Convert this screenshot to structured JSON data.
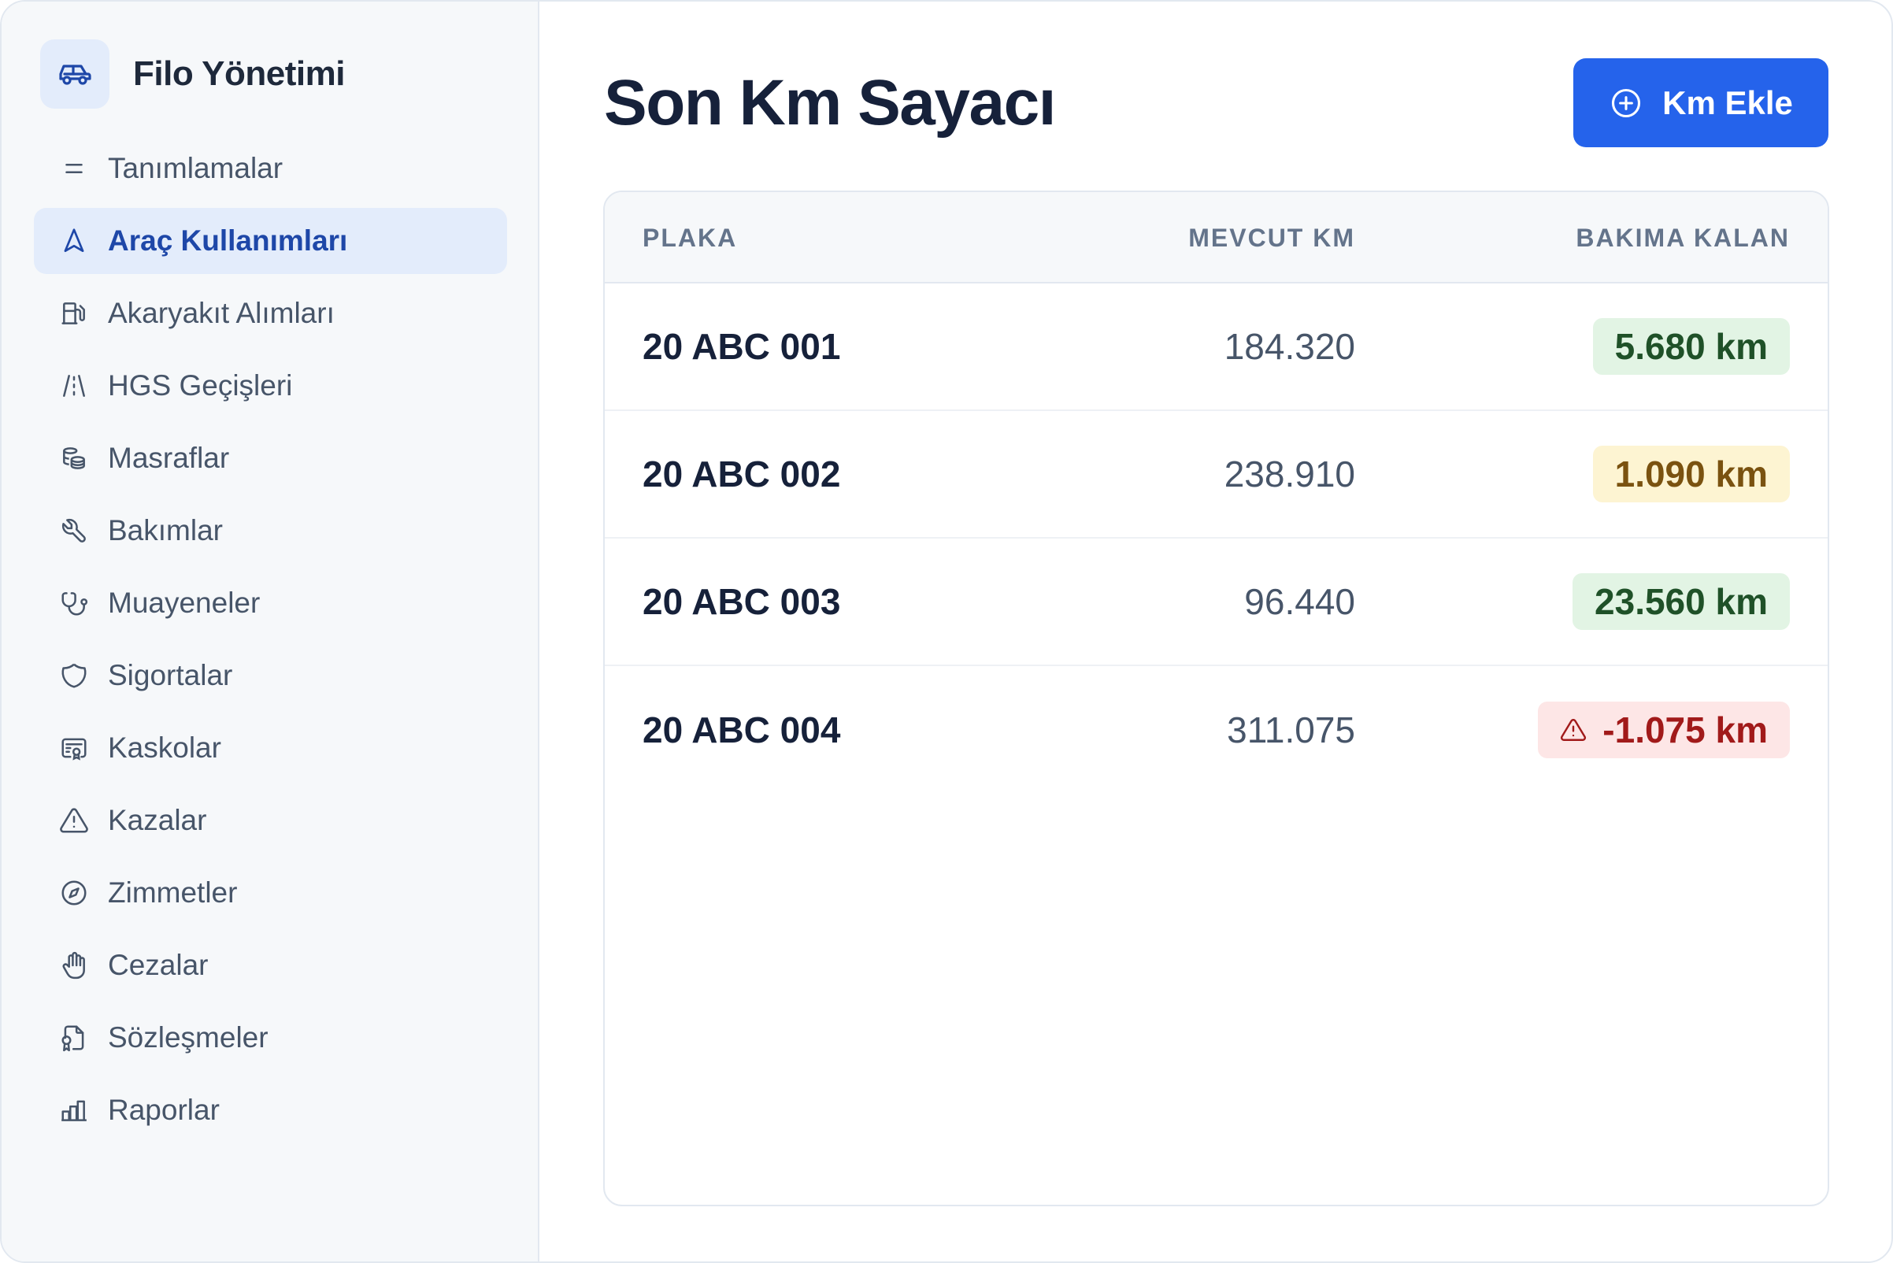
{
  "brand": {
    "title": "Filo Yönetimi",
    "icon": "car-icon"
  },
  "sidebar": {
    "items": [
      {
        "label": "Tanımlamalar",
        "icon": "menu-lines-icon",
        "active": false
      },
      {
        "label": "Araç Kullanımları",
        "icon": "navigation-icon",
        "active": true
      },
      {
        "label": "Akaryakıt Alımları",
        "icon": "fuel-icon",
        "active": false
      },
      {
        "label": "HGS Geçişleri",
        "icon": "road-icon",
        "active": false
      },
      {
        "label": "Masraflar",
        "icon": "coins-icon",
        "active": false
      },
      {
        "label": "Bakımlar",
        "icon": "wrench-icon",
        "active": false
      },
      {
        "label": "Muayeneler",
        "icon": "stethoscope-icon",
        "active": false
      },
      {
        "label": "Sigortalar",
        "icon": "shield-icon",
        "active": false
      },
      {
        "label": "Kaskolar",
        "icon": "certificate-icon",
        "active": false
      },
      {
        "label": "Kazalar",
        "icon": "warning-icon",
        "active": false
      },
      {
        "label": "Zimmetler",
        "icon": "compass-icon",
        "active": false
      },
      {
        "label": "Cezalar",
        "icon": "hand-icon",
        "active": false
      },
      {
        "label": "Sözleşmeler",
        "icon": "contract-icon",
        "active": false
      },
      {
        "label": "Raporlar",
        "icon": "bar-chart-icon",
        "active": false
      }
    ]
  },
  "main": {
    "title": "Son Km Sayacı",
    "add_button": {
      "label": "Km Ekle",
      "icon": "plus-circle-icon"
    }
  },
  "table": {
    "columns": [
      "PLAKA",
      "MEVCUT KM",
      "BAKIMA KALAN"
    ],
    "rows": [
      {
        "plate": "20 ABC 001",
        "km": "184.320",
        "remaining": "5.680 km",
        "status": "green"
      },
      {
        "plate": "20 ABC 002",
        "km": "238.910",
        "remaining": "1.090 km",
        "status": "amber"
      },
      {
        "plate": "20 ABC 003",
        "km": "96.440",
        "remaining": "23.560 km",
        "status": "green"
      },
      {
        "plate": "20 ABC 004",
        "km": "311.075",
        "remaining": "-1.075 km",
        "status": "red"
      }
    ]
  },
  "colors": {
    "accent": "#2563eb",
    "active_nav_bg": "#e3ecfb",
    "ok": "#e2f4e4",
    "warn": "#fdf4d2",
    "overdue": "#fde6e6"
  }
}
